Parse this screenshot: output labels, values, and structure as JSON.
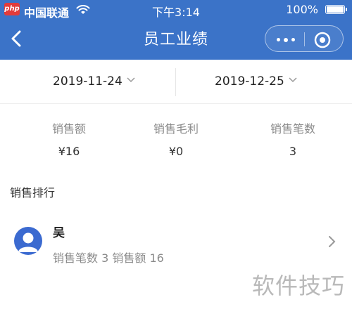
{
  "status_bar": {
    "logo_text": "php",
    "carrier": "中国联通",
    "time": "下午3:14",
    "battery": "100%"
  },
  "navbar": {
    "title": "员工业绩"
  },
  "date_range": {
    "start": "2019-11-24",
    "end": "2019-12-25"
  },
  "stats": [
    {
      "label": "销售额",
      "value": "¥16"
    },
    {
      "label": "销售毛利",
      "value": "¥0"
    },
    {
      "label": "销售笔数",
      "value": "3"
    }
  ],
  "ranking": {
    "title": "销售排行",
    "items": [
      {
        "name": "吴",
        "summary": "销售笔数 3 销售额 16"
      }
    ]
  },
  "watermark": "软件技巧",
  "colors": {
    "header_bg": "#3b73c8",
    "avatar_bg": "#3b6ad0"
  }
}
